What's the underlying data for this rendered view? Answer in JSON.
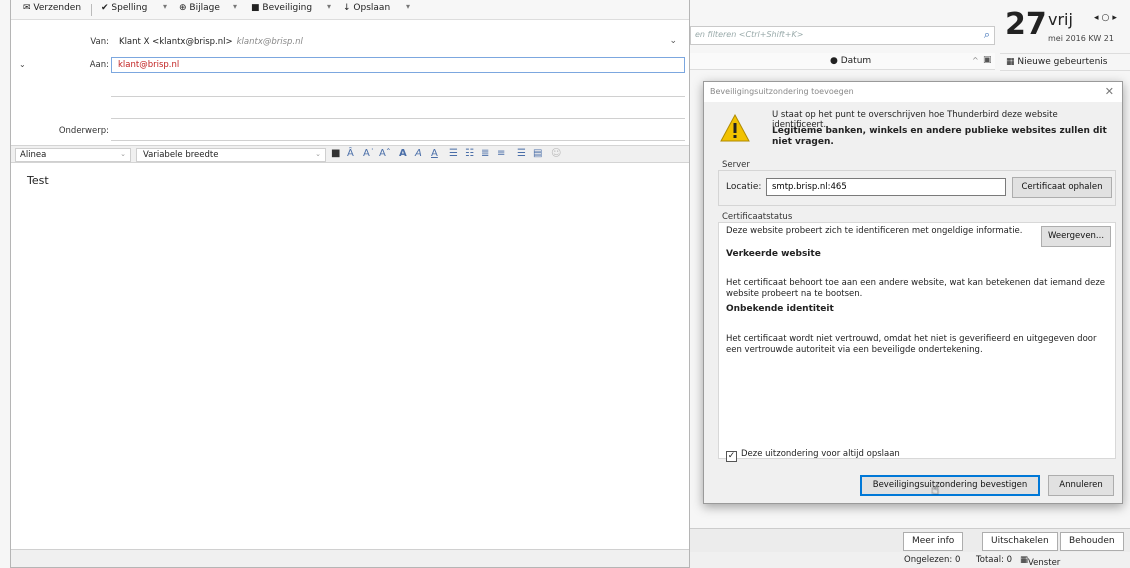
{
  "compose": {
    "toolbar": {
      "send": "Verzenden",
      "spelling": "Spelling",
      "attachment": "Bijlage",
      "security": "Beveiliging",
      "save": "Opslaan"
    },
    "from_label": "Van:",
    "from_value": "Klant X <klantx@brisp.nl>",
    "from_secondary": "klantx@brisp.nl",
    "to_label": "Aan:",
    "to_value": "klant@brisp.nl",
    "subject_label": "Onderwerp:",
    "paragraph_style": "Alinea",
    "font": "Variabele breedte",
    "body_text": "Test"
  },
  "main": {
    "search_placeholder": "en filteren <Ctrl+Shift+K>",
    "column_date": "Datum",
    "buttons": {
      "more_info": "Meer info",
      "disable": "Uitschakelen",
      "keep": "Behouden"
    },
    "status": {
      "unread": "Ongelezen: 0",
      "total": "Totaal: 0",
      "today_pane": "Venster Vandaag"
    }
  },
  "calendar": {
    "day_number": "27",
    "day_name": "vrij",
    "month_week": "mei 2016  KW 21",
    "new_event": "Nieuwe gebeurtenis"
  },
  "dialog": {
    "title": "Beveiligingsuitzondering toevoegen",
    "warning_line1": "U staat op het punt te overschrijven hoe Thunderbird deze website identificeert.",
    "warning_line2": "Legitieme banken, winkels en andere publieke websites zullen dit niet vragen.",
    "server_label": "Server",
    "location_label": "Locatie:",
    "location_value": "smtp.brisp.nl:465",
    "get_cert_button": "Certificaat ophalen",
    "cert_status_label": "Certificaatstatus",
    "cert_status_text": "Deze website probeert zich te identificeren met ongeldige informatie.",
    "view_button": "Weergeven...",
    "wrong_site_title": "Verkeerde website",
    "wrong_site_text": "Het certificaat behoort toe aan een andere website, wat kan betekenen dat iemand deze website probeert na te bootsen.",
    "unknown_identity_title": "Onbekende identiteit",
    "unknown_identity_text": "Het certificaat wordt niet vertrouwd, omdat het niet is geverifieerd en uitgegeven door een vertrouwde autoriteit via een beveiligde ondertekening.",
    "permanent_checkbox": "Deze uitzondering voor altijd opslaan",
    "permanent_checked": true,
    "confirm_button": "Beveiligingsuitzondering bevestigen",
    "cancel_button": "Annuleren"
  },
  "colors": {
    "accent": "#0078d7",
    "to_address": "#c12020",
    "warning": "#f2c200"
  }
}
